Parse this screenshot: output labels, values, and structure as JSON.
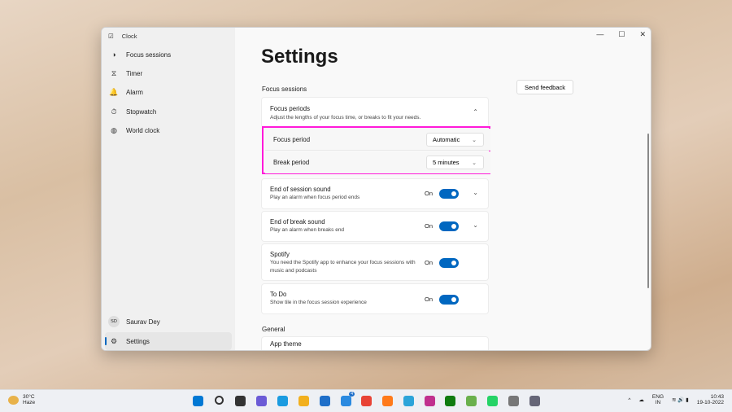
{
  "app": {
    "title": "Clock",
    "window_controls": [
      "—",
      "☐",
      "✕"
    ]
  },
  "sidebar": {
    "items": [
      {
        "label": "Focus sessions",
        "icon": "◑"
      },
      {
        "label": "Timer",
        "icon": "⧖"
      },
      {
        "label": "Alarm",
        "icon": "🔔"
      },
      {
        "label": "Stopwatch",
        "icon": "⏱"
      },
      {
        "label": "World clock",
        "icon": "◍"
      }
    ],
    "user": {
      "initials": "SD",
      "name": "Saurav Dey"
    },
    "settings": {
      "label": "Settings",
      "icon": "⚙"
    }
  },
  "page": {
    "title": "Settings",
    "send_feedback": "Send feedback",
    "section_focus": "Focus sessions",
    "section_general": "General"
  },
  "focus_periods": {
    "title": "Focus periods",
    "desc": "Adjust the lengths of your focus time, or breaks to fit your needs.",
    "focus_label": "Focus period",
    "focus_value": "Automatic",
    "break_label": "Break period",
    "break_value": "5 minutes"
  },
  "rows": [
    {
      "title": "End of session sound",
      "desc": "Play an alarm when focus period ends",
      "state": "On"
    },
    {
      "title": "End of break sound",
      "desc": "Play an alarm when breaks end",
      "state": "On"
    },
    {
      "title": "Spotify",
      "desc": "You need the Spotify app to enhance your focus sessions with music and podcasts",
      "state": "On"
    },
    {
      "title": "To Do",
      "desc": "Show tile in the focus session experience",
      "state": "On"
    }
  ],
  "general": {
    "app_theme": "App theme"
  },
  "taskbar": {
    "temp": "30°C",
    "weather": "Haze",
    "lang": "ENG",
    "region": "IN",
    "time": "10:43",
    "date": "19-10-2022",
    "mail_badge": "4",
    "icon_colors": [
      "#0078d4",
      "#333",
      "#333",
      "#6b5bd6",
      "#1a9be0",
      "#f2b01e",
      "#1f6fc9",
      "#2a8ae0",
      "#e84335",
      "#ff7a1a",
      "#2ba4d9",
      "#c0308e",
      "#107c10",
      "#6ab04c",
      "#25d366",
      "#777",
      "#667"
    ]
  }
}
